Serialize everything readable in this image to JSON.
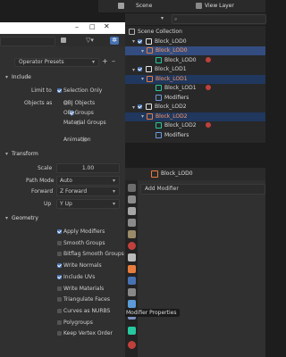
{
  "outliner": {
    "scene_label": "Scene",
    "viewlayer_label": "View Layer",
    "search_placeholder": "",
    "items": [
      {
        "label": "Scene Collection",
        "depth": 0,
        "kind": "scene"
      },
      {
        "label": "Block_LOD0",
        "depth": 1,
        "kind": "collection"
      },
      {
        "label": "Block_LOD0",
        "depth": 2,
        "kind": "object",
        "selected": true
      },
      {
        "label": "Block_LOD0",
        "depth": 3,
        "kind": "mesh"
      },
      {
        "label": "Block_LOD1",
        "depth": 1,
        "kind": "collection"
      },
      {
        "label": "Block_LOD1",
        "depth": 2,
        "kind": "object",
        "highlight": true
      },
      {
        "label": "Block_LOD1",
        "depth": 3,
        "kind": "mesh"
      },
      {
        "label": "Modifiers",
        "depth": 3,
        "kind": "modifiers"
      },
      {
        "label": "Block_LOD2",
        "depth": 1,
        "kind": "collection"
      },
      {
        "label": "Block_LOD2",
        "depth": 2,
        "kind": "object",
        "highlight": true
      },
      {
        "label": "Block_LOD2",
        "depth": 3,
        "kind": "mesh"
      },
      {
        "label": "Modifiers",
        "depth": 3,
        "kind": "modifiers"
      }
    ]
  },
  "properties": {
    "object_name": "Block_LOD0",
    "add_modifier_label": "Add Modifier",
    "tooltip": "Modifier Properties"
  },
  "export": {
    "presets_label": "Operator Presets",
    "include": {
      "header": "Include",
      "limit_to_label": "Limit to",
      "selection_only": "Selection Only",
      "objects_as_label": "Objects as",
      "obj_objects": "OBJ Objects",
      "obj_groups": "OBJ Groups",
      "material_groups": "Material Groups",
      "animation": "Animation"
    },
    "transform": {
      "header": "Transform",
      "scale_label": "Scale",
      "scale_value": "1.00",
      "path_mode_label": "Path Mode",
      "path_mode_value": "Auto",
      "forward_label": "Forward",
      "forward_value": "Z Forward",
      "up_label": "Up",
      "up_value": "Y Up"
    },
    "geometry": {
      "header": "Geometry",
      "options": [
        {
          "label": "Apply Modifiers",
          "checked": true
        },
        {
          "label": "Smooth Groups",
          "checked": false
        },
        {
          "label": "Bitflag Smooth Groups",
          "checked": false
        },
        {
          "label": "Write Normals",
          "checked": true
        },
        {
          "label": "Include UVs",
          "checked": true
        },
        {
          "label": "Write Materials",
          "checked": false
        },
        {
          "label": "Triangulate Faces",
          "checked": false
        },
        {
          "label": "Curves as NURBS",
          "checked": false
        },
        {
          "label": "Polygroups",
          "checked": false
        },
        {
          "label": "Keep Vertex Order",
          "checked": false
        }
      ]
    }
  },
  "colors": {
    "accent": "#4772b3",
    "selected_row": "#334d80",
    "object_orange": "#e87d3e",
    "mesh_green": "#26c9a0",
    "modifier_blue": "#6b9be0"
  }
}
